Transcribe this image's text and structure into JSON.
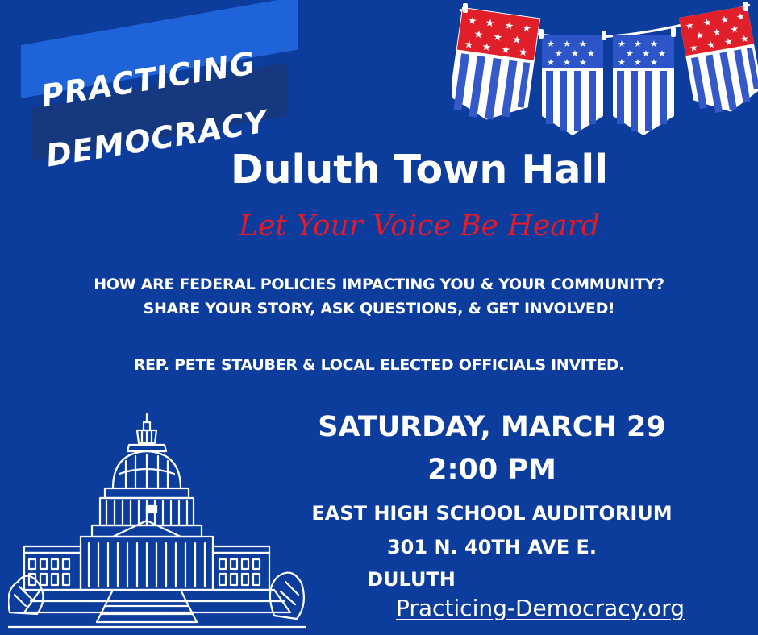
{
  "brand": {
    "line1": "PRACTICING",
    "line2": "DEMOCRACY"
  },
  "event": {
    "title": "Duluth Town Hall",
    "tagline": "Let Your Voice Be Heard",
    "question_line1": "HOW ARE FEDERAL POLICIES IMPACTING YOU & YOUR COMMUNITY?",
    "question_line2": "SHARE YOUR STORY, ASK QUESTIONS, & GET INVOLVED!",
    "invited": "REP. PETE STAUBER & LOCAL ELECTED OFFICIALS INVITED.",
    "date": "SATURDAY, MARCH 29",
    "time": "2:00 PM",
    "venue": "EAST HIGH SCHOOL AUDITORIUM",
    "address": "301 N. 40TH AVE E.",
    "city": "DULUTH",
    "website": "Practicing-Democracy.org"
  },
  "colors": {
    "background": "#0c3c9c",
    "brand_band_light": "#1f63d8",
    "brand_band_dark": "#16387f",
    "tagline_red": "#e11b2b",
    "flag_red": "#e01f2b",
    "flag_blue": "#2d55c8",
    "white": "#ffffff"
  },
  "icons": [
    "patriotic-bunting-icon",
    "capitol-building-icon"
  ]
}
